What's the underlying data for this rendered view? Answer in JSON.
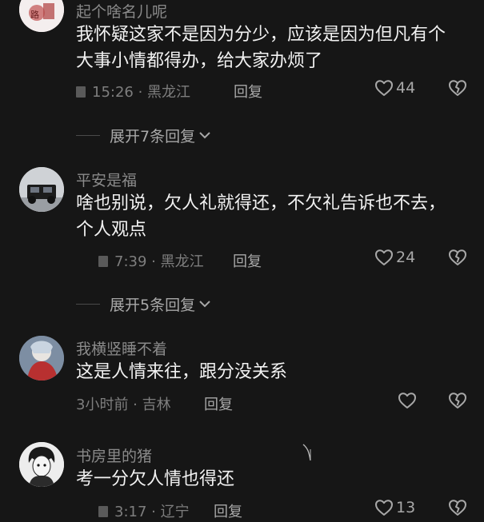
{
  "comments": [
    {
      "username": "起个啥名儿呢",
      "text": "我怀疑这家不是因为分少，应该是因为但凡有个大事小情都得办，给大家办烦了",
      "time": "15:26 · 黑龙江",
      "reply": "回复",
      "likes": "44",
      "expand": "展开7条回复"
    },
    {
      "username": "平安是福",
      "text": "啥也别说，欠人礼就得还，不欠礼告诉也不去，个人观点",
      "time": "7:39 · 黑龙江",
      "reply": "回复",
      "likes": "24",
      "expand": "展开5条回复"
    },
    {
      "username": "我横竖睡不着",
      "text": "这是人情来往，跟分没关系",
      "time": "3小时前 · 吉林",
      "reply": "回复",
      "likes": ""
    },
    {
      "username": "书房里的猪",
      "text": "考一分欠人情也得还",
      "time": "3:17 · 辽宁",
      "reply": "回复",
      "likes": "13"
    }
  ],
  "icons": {
    "like": "heart-outline-icon",
    "dislike": "broken-heart-icon",
    "expand": "chevron-down-icon"
  },
  "colors": {
    "background": "#161616",
    "username": "#8a8a8a",
    "text": "#f2f2f2",
    "meta": "#7e7e7e",
    "action": "#a8a8a8"
  }
}
